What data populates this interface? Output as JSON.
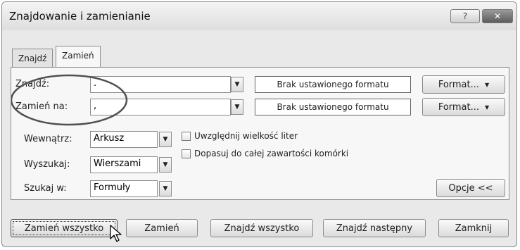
{
  "window": {
    "title": "Znajdowanie i zamienianie",
    "help_label": "?",
    "close_label": "✕"
  },
  "tabs": [
    {
      "label": "Znajdź"
    },
    {
      "label": "Zamień"
    }
  ],
  "find": {
    "label": "Znajdź:",
    "value": ".",
    "format_status": "Brak ustawionego formatu",
    "format_button": "Format...",
    "dropdown_glyph": "▼"
  },
  "replace": {
    "label": "Zamień na:",
    "value": ",",
    "format_status": "Brak ustawionego formatu",
    "format_button": "Format..."
  },
  "options": {
    "within": {
      "label": "Wewnątrz:",
      "value": "Arkusz"
    },
    "search": {
      "label": "Wyszukaj:",
      "value": "Wierszami"
    },
    "look_in": {
      "label": "Szukaj w:",
      "value": "Formuły"
    },
    "match_case": {
      "label": "Uwzględnij wielkość liter",
      "checked": false
    },
    "match_entire": {
      "label": "Dopasuj do całej zawartości komórki",
      "checked": false
    },
    "options_button": "Opcje <<"
  },
  "buttons": {
    "replace_all": "Zamień wszystko",
    "replace": "Zamień",
    "find_all": "Znajdź wszystko",
    "find_next": "Znajdź następny",
    "close": "Zamknij"
  },
  "colors": {
    "annotation_circle": "#505050",
    "focus_ring": "#333333"
  }
}
